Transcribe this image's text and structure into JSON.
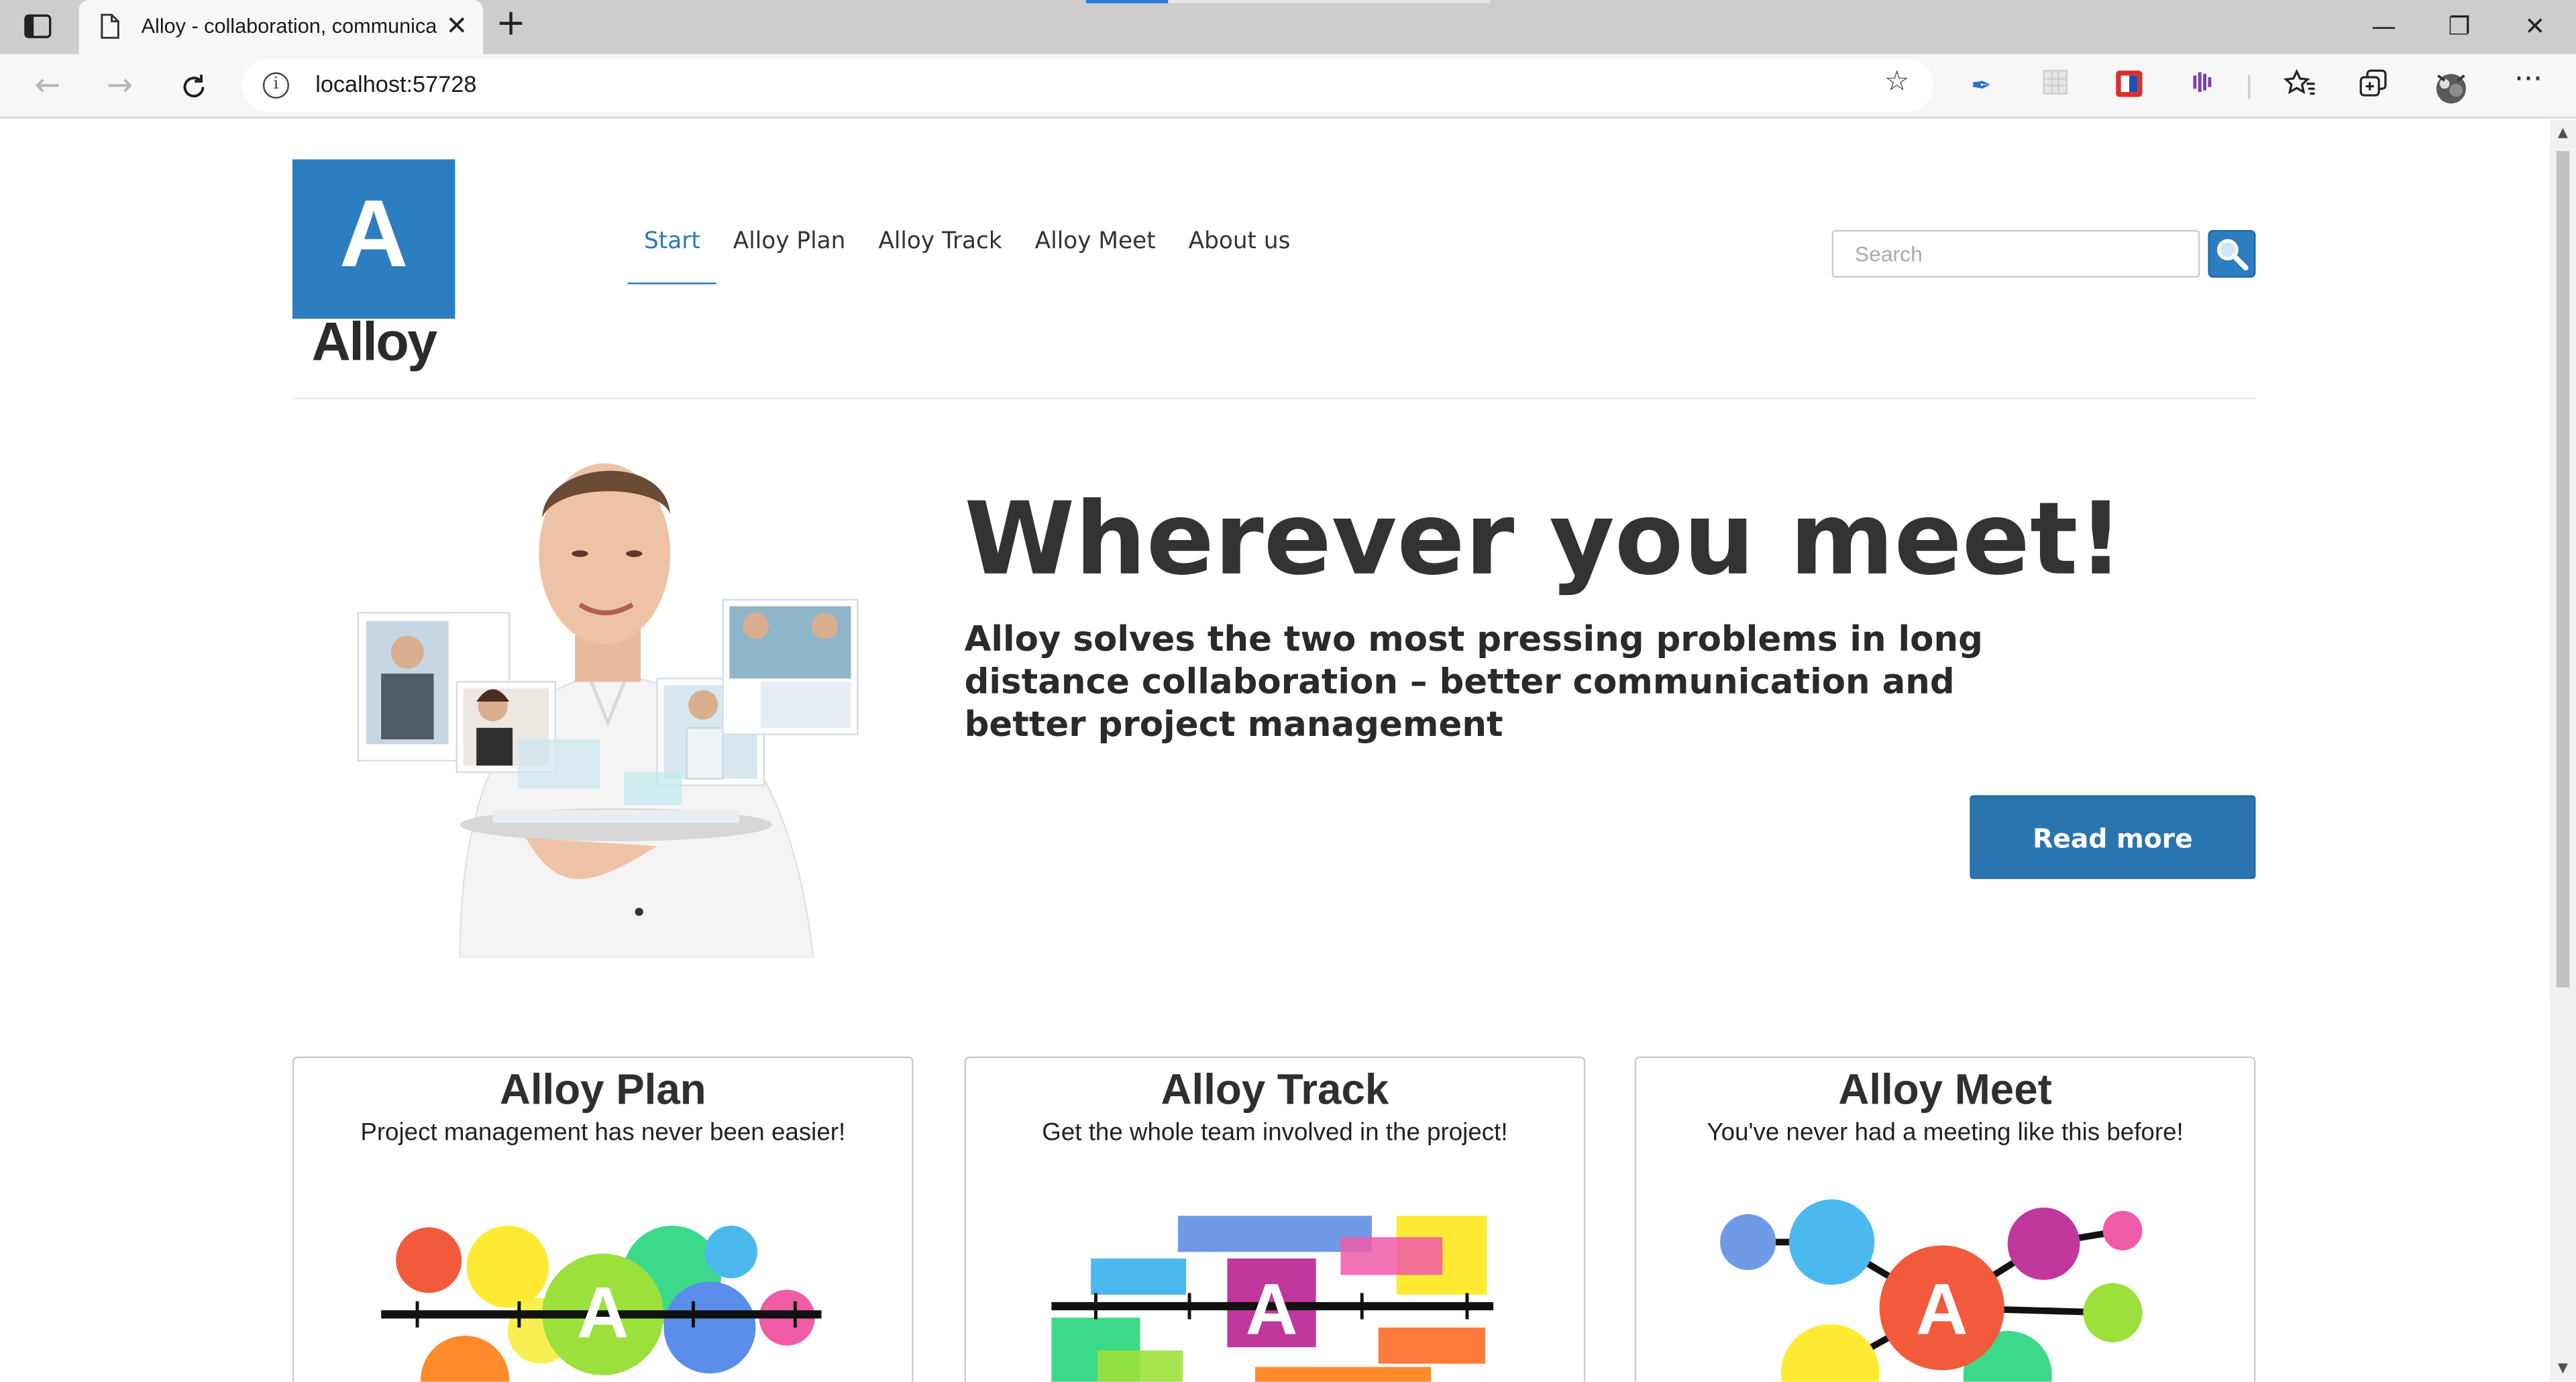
{
  "browser": {
    "tab_title": "Alloy - collaboration, communication",
    "tab_close": "✕",
    "new_tab": "+",
    "url": "localhost:57728",
    "window_minimize": "—",
    "window_restore": "❐",
    "window_close": "✕"
  },
  "site": {
    "logo_letter": "A",
    "logo_word": "Alloy",
    "nav": [
      {
        "label": "Start"
      },
      {
        "label": "Alloy Plan"
      },
      {
        "label": "Alloy Track"
      },
      {
        "label": "Alloy Meet"
      },
      {
        "label": "About us"
      }
    ],
    "search_placeholder": "Search"
  },
  "hero": {
    "title": "Wherever you meet!",
    "subtitle": "Alloy solves the two most pressing problems in long distance collaboration – better communication and better project management",
    "button": "Read more"
  },
  "cards": [
    {
      "title": "Alloy Plan",
      "desc": "Project management has never been easier!"
    },
    {
      "title": "Alloy Track",
      "desc": "Get the whole team involved in the project!"
    },
    {
      "title": "Alloy Meet",
      "desc": "You've never had a meeting like this before!"
    }
  ],
  "colors": {
    "brand_blue": "#2d7ec1",
    "active_nav": "#2a7ab7",
    "button_blue": "#2a75b0"
  },
  "icons": [
    "tab-actions-icon",
    "page-icon",
    "back-arrow-icon",
    "forward-arrow-icon",
    "refresh-icon",
    "info-icon",
    "add-favorite-icon",
    "quill-extension-icon",
    "grid-extension-icon",
    "red-extension-icon",
    "purple-extension-icon",
    "favorites-icon",
    "collections-icon",
    "profile-avatar-icon",
    "more-icon",
    "search-icon"
  ]
}
